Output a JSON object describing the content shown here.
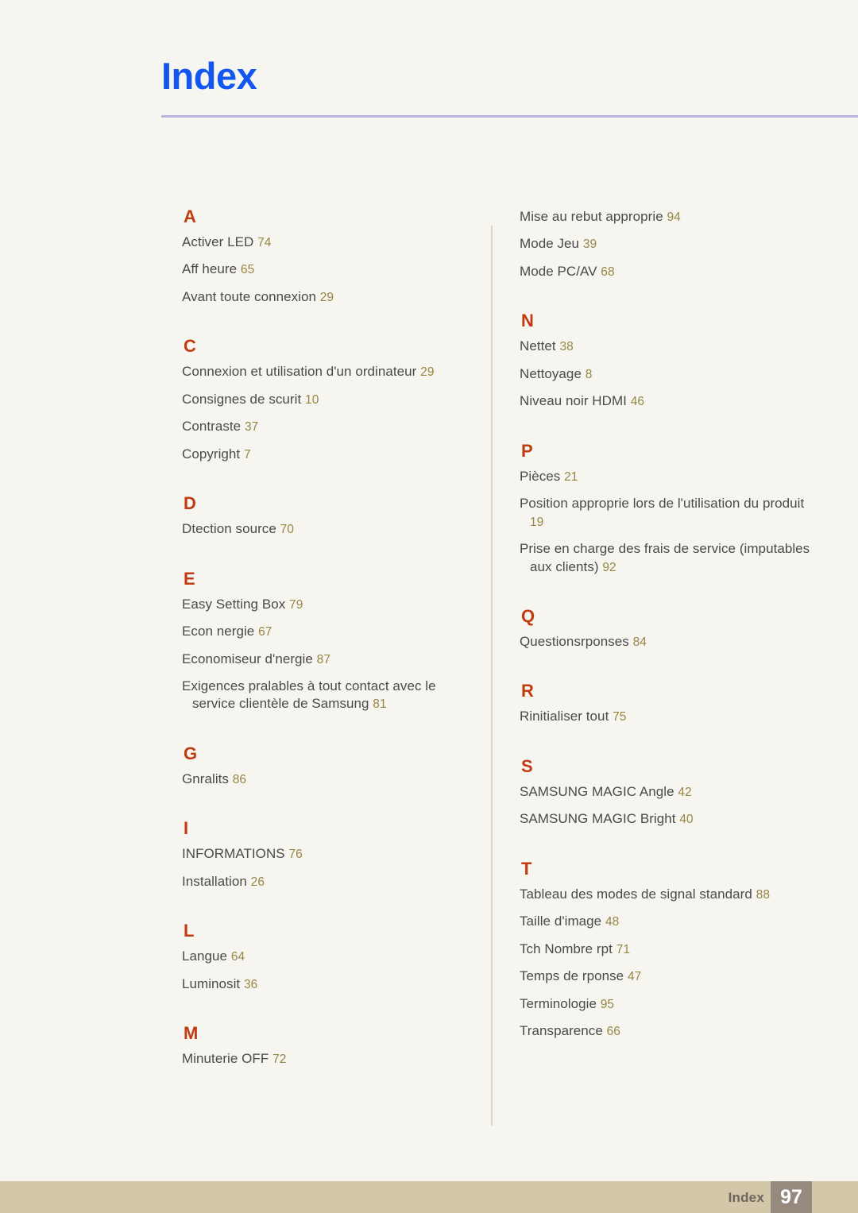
{
  "header": {
    "title": "Index",
    "rule_color": "#b9b4dd",
    "title_color": "#1456f0"
  },
  "theme": {
    "background": "#f7f5ef",
    "letter_color": "#c03c10",
    "entry_color": "#4b4a49",
    "page_number_color": "#968645",
    "divider_color": "#e0d3c6",
    "footer_band_color": "#d3c7a9",
    "footer_box_color": "#968a7e"
  },
  "columns": {
    "left": [
      {
        "letter": "A",
        "entries": [
          {
            "text": "Activer LED",
            "page": "74"
          },
          {
            "text": "Aff heure",
            "page": "65"
          },
          {
            "text": "Avant toute connexion",
            "page": "29"
          }
        ]
      },
      {
        "letter": "C",
        "entries": [
          {
            "text": "Connexion et utilisation d'un ordinateur",
            "page": "29"
          },
          {
            "text": "Consignes de scurit",
            "page": "10"
          },
          {
            "text": "Contraste",
            "page": "37"
          },
          {
            "text": "Copyright",
            "page": "7"
          }
        ]
      },
      {
        "letter": "D",
        "entries": [
          {
            "text": "Dtection source",
            "page": "70"
          }
        ]
      },
      {
        "letter": "E",
        "entries": [
          {
            "text": "Easy Setting Box",
            "page": "79"
          },
          {
            "text": "Econ nergie",
            "page": "67"
          },
          {
            "text": "Economiseur d'nergie",
            "page": "87"
          },
          {
            "text": "Exigences pralables à tout contact avec le service clientèle de Samsung",
            "page": "81"
          }
        ]
      },
      {
        "letter": "G",
        "entries": [
          {
            "text": "Gnralits",
            "page": "86"
          }
        ]
      },
      {
        "letter": "I",
        "entries": [
          {
            "text": "INFORMATIONS",
            "page": "76"
          },
          {
            "text": "Installation",
            "page": "26"
          }
        ]
      },
      {
        "letter": "L",
        "entries": [
          {
            "text": "Langue",
            "page": "64"
          },
          {
            "text": "Luminosit",
            "page": "36"
          }
        ]
      },
      {
        "letter": "M",
        "entries": [
          {
            "text": "Minuterie OFF",
            "page": "72"
          }
        ]
      }
    ],
    "right": [
      {
        "letter": "",
        "entries": [
          {
            "text": "Mise au rebut approprie",
            "page": "94"
          },
          {
            "text": "Mode Jeu",
            "page": "39"
          },
          {
            "text": "Mode PC/AV",
            "page": "68"
          }
        ]
      },
      {
        "letter": "N",
        "entries": [
          {
            "text": "Nettet",
            "page": "38"
          },
          {
            "text": "Nettoyage",
            "page": "8"
          },
          {
            "text": "Niveau noir HDMI",
            "page": "46"
          }
        ]
      },
      {
        "letter": "P",
        "entries": [
          {
            "text": "Pièces",
            "page": "21"
          },
          {
            "text": "Position approprie lors de l'utilisation du produit",
            "page": "19"
          },
          {
            "text": "Prise en charge des frais de service (imputables aux clients)",
            "page": "92"
          }
        ]
      },
      {
        "letter": "Q",
        "entries": [
          {
            "text": "Questionsrponses",
            "page": "84"
          }
        ]
      },
      {
        "letter": "R",
        "entries": [
          {
            "text": "Rinitialiser tout",
            "page": "75"
          }
        ]
      },
      {
        "letter": "S",
        "entries": [
          {
            "text": "SAMSUNG MAGIC Angle",
            "page": "42"
          },
          {
            "text": "SAMSUNG MAGIC Bright",
            "page": "40"
          }
        ]
      },
      {
        "letter": "T",
        "entries": [
          {
            "text": "Tableau des modes de signal standard",
            "page": "88"
          },
          {
            "text": "Taille d'image",
            "page": "48"
          },
          {
            "text": "Tch Nombre rpt",
            "page": "71"
          },
          {
            "text": "Temps de rponse",
            "page": "47"
          },
          {
            "text": "Terminologie",
            "page": "95"
          },
          {
            "text": "Transparence",
            "page": "66"
          }
        ]
      }
    ]
  },
  "footer": {
    "label": "Index",
    "page_number": "97"
  }
}
